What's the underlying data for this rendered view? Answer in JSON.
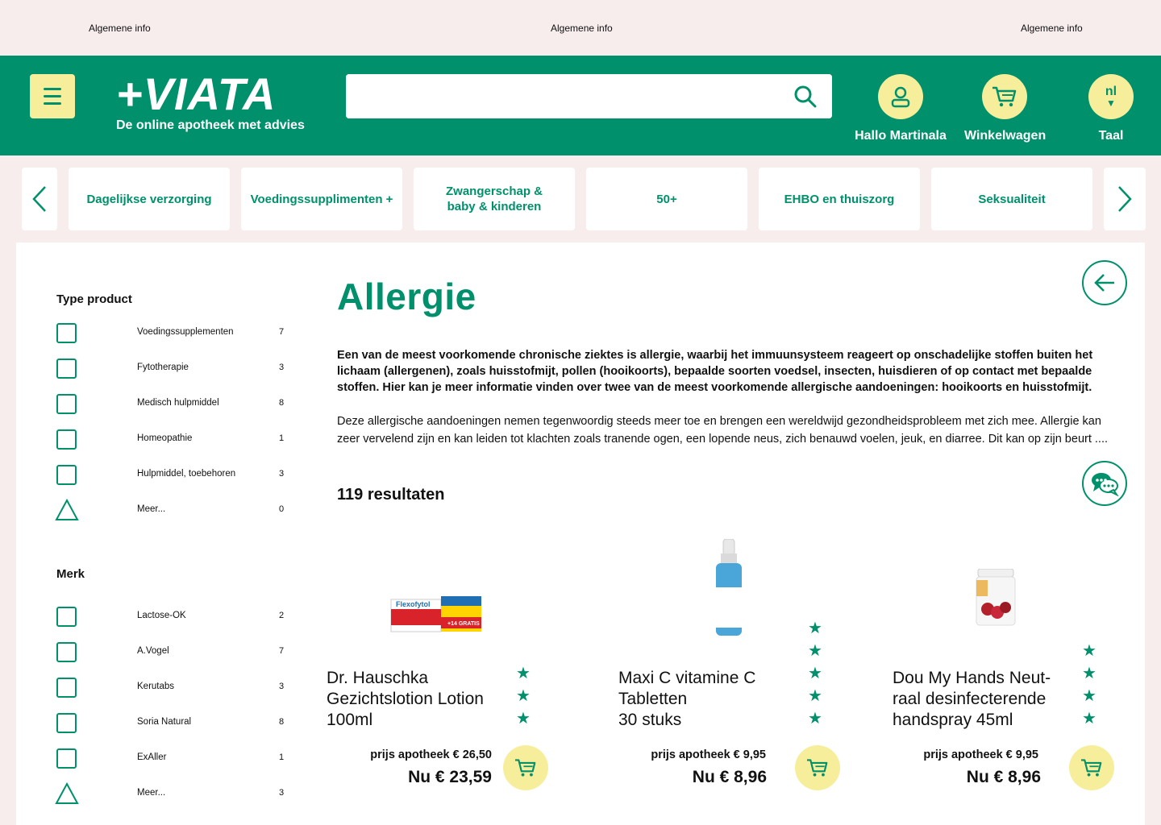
{
  "top_bar": {
    "info_1": "Algemene info",
    "info_2": "Algemene info",
    "info_3": "Algemene info"
  },
  "header": {
    "logo": "+VIATA",
    "tagline": "De online apotheek met advies",
    "search_placeholder": "",
    "account_label": "Hallo Martinala",
    "cart_label": "Winkelwagen",
    "language_code": "nl",
    "language_label": "Taal"
  },
  "categories": [
    "Dagelijkse verzorging",
    "Voedingssupplimenten +",
    "Zwangerschap & baby & kinderen",
    "50+",
    "EHBO en thuiszorg",
    "Seksualiteit"
  ],
  "filters": {
    "type_title": "Type product",
    "type_items": [
      {
        "label": "Voedingssupplementen",
        "count": "7"
      },
      {
        "label": "Fytotherapie",
        "count": "3"
      },
      {
        "label": "Medisch hulpmiddel",
        "count": "8"
      },
      {
        "label": "Homeopathie",
        "count": "1"
      },
      {
        "label": "Hulpmiddel, toebehoren",
        "count": "3"
      }
    ],
    "type_more": {
      "label": "Meer...",
      "count": "0"
    },
    "brand_title": "Merk",
    "brand_items": [
      {
        "label": "Lactose-OK",
        "count": "2"
      },
      {
        "label": "A.Vogel",
        "count": "7"
      },
      {
        "label": "Kerutabs",
        "count": "3"
      },
      {
        "label": "Soria Natural",
        "count": "8"
      },
      {
        "label": "ExAller",
        "count": "1"
      }
    ],
    "brand_more": {
      "label": "Meer...",
      "count": "3"
    }
  },
  "content": {
    "title": "Allergie",
    "intro_bold": "Een van de meest voorkomende chronische ziektes is allergie, waarbij het immuunsysteem reageert op onschadelijke stoffen buiten het lichaam (allergenen), zoals huisstofmijt, pollen (hooikoorts), bepaalde soorten voedsel, insecten, huisdieren of op contact met bepaalde stoffen. Hier kan je meer informatie vinden over twee van de meest voorkomende allergische aandoeningen: hooikoorts en huisstofmijt.",
    "intro_text": "Deze allergische aandoeningen nemen tegenwoordig steeds meer toe en brengen een wereldwijd gezondheidsprobleem met zich mee. Allergie kan zeer vervelend zijn en kan leiden tot klachten zoals tranende ogen, een lopende neus, zich benauwd voelen, jeuk, en diarree. Dit kan op zijn beurt ....",
    "results": "119 resultaten"
  },
  "products": [
    {
      "name_line1": "Dr. Hauschka",
      "name_line2": "Gezichtslotion Lotion",
      "name_line3": "100ml",
      "stars": 3,
      "list_price": "prijs apotheek  € 26,50",
      "price": "Nu € 23,59",
      "box_brand": "Flexofytol",
      "box_badge": "+14 GRATIS"
    },
    {
      "name_line1": "Maxi C vitamine C",
      "name_line2": "Tabletten",
      "name_line3": "30 stuks",
      "stars": 5,
      "list_price": "prijs apotheek € 9,95",
      "price": "Nu € 8,96"
    },
    {
      "name_line1": "Dou My Hands Neut-",
      "name_line2": "raal desinfecterende",
      "name_line3": "handspray 45ml",
      "stars": 4,
      "list_price": "prijs apotheek € 9,95",
      "price": "Nu € 8,96"
    }
  ],
  "colors": {
    "primary": "#00906b",
    "accent": "#f7ee9c",
    "background": "#f7eded"
  }
}
